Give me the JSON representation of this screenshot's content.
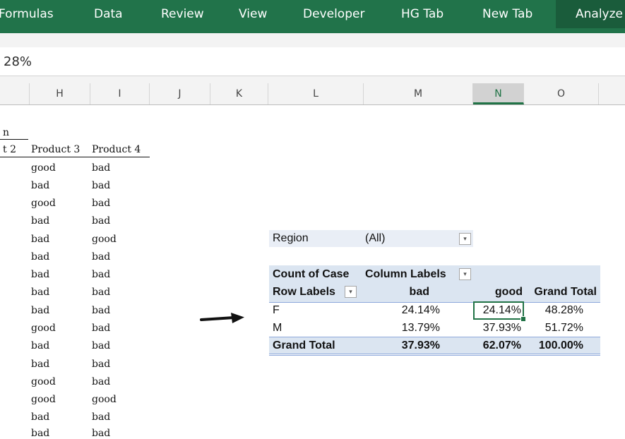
{
  "ribbon": {
    "tabs": [
      "Formulas",
      "Data",
      "Review",
      "View",
      "Developer",
      "HG Tab",
      "New Tab",
      "Analyze"
    ],
    "selected": "Analyze"
  },
  "formula_bar": {
    "value": "28%"
  },
  "columns": [
    "H",
    "I",
    "J",
    "K",
    "L",
    "M",
    "N",
    "O"
  ],
  "active_column": "N",
  "source_table": {
    "title_fragment": "n",
    "headers": [
      "t 2",
      "Product 3",
      "Product 4"
    ],
    "rows": [
      [
        "good",
        "bad"
      ],
      [
        "bad",
        "bad"
      ],
      [
        "good",
        "bad"
      ],
      [
        "bad",
        "bad"
      ],
      [
        "bad",
        "good"
      ],
      [
        "bad",
        "bad"
      ],
      [
        "bad",
        "bad"
      ],
      [
        "bad",
        "bad"
      ],
      [
        "bad",
        "bad"
      ],
      [
        "good",
        "bad"
      ],
      [
        "bad",
        "bad"
      ],
      [
        "bad",
        "bad"
      ],
      [
        "good",
        "bad"
      ],
      [
        "good",
        "good"
      ],
      [
        "bad",
        "bad"
      ],
      [
        "bad",
        "bad"
      ]
    ]
  },
  "pivot": {
    "filter_label": "Region",
    "filter_value": "(All)",
    "value_field": "Count of Case",
    "column_labels": "Column Labels",
    "row_labels": "Row Labels",
    "col_headers": [
      "bad",
      "good",
      "Grand Total"
    ],
    "rows": [
      {
        "label": "F",
        "values": [
          "24.14%",
          "24.14%",
          "48.28%"
        ]
      },
      {
        "label": "M",
        "values": [
          "13.79%",
          "37.93%",
          "51.72%"
        ]
      }
    ],
    "grand_total": {
      "label": "Grand Total",
      "values": [
        "37.93%",
        "62.07%",
        "100.00%"
      ]
    }
  },
  "colors": {
    "ribbon": "#21734a",
    "pivot_band": "#dbe5f1",
    "selection": "#217346"
  }
}
